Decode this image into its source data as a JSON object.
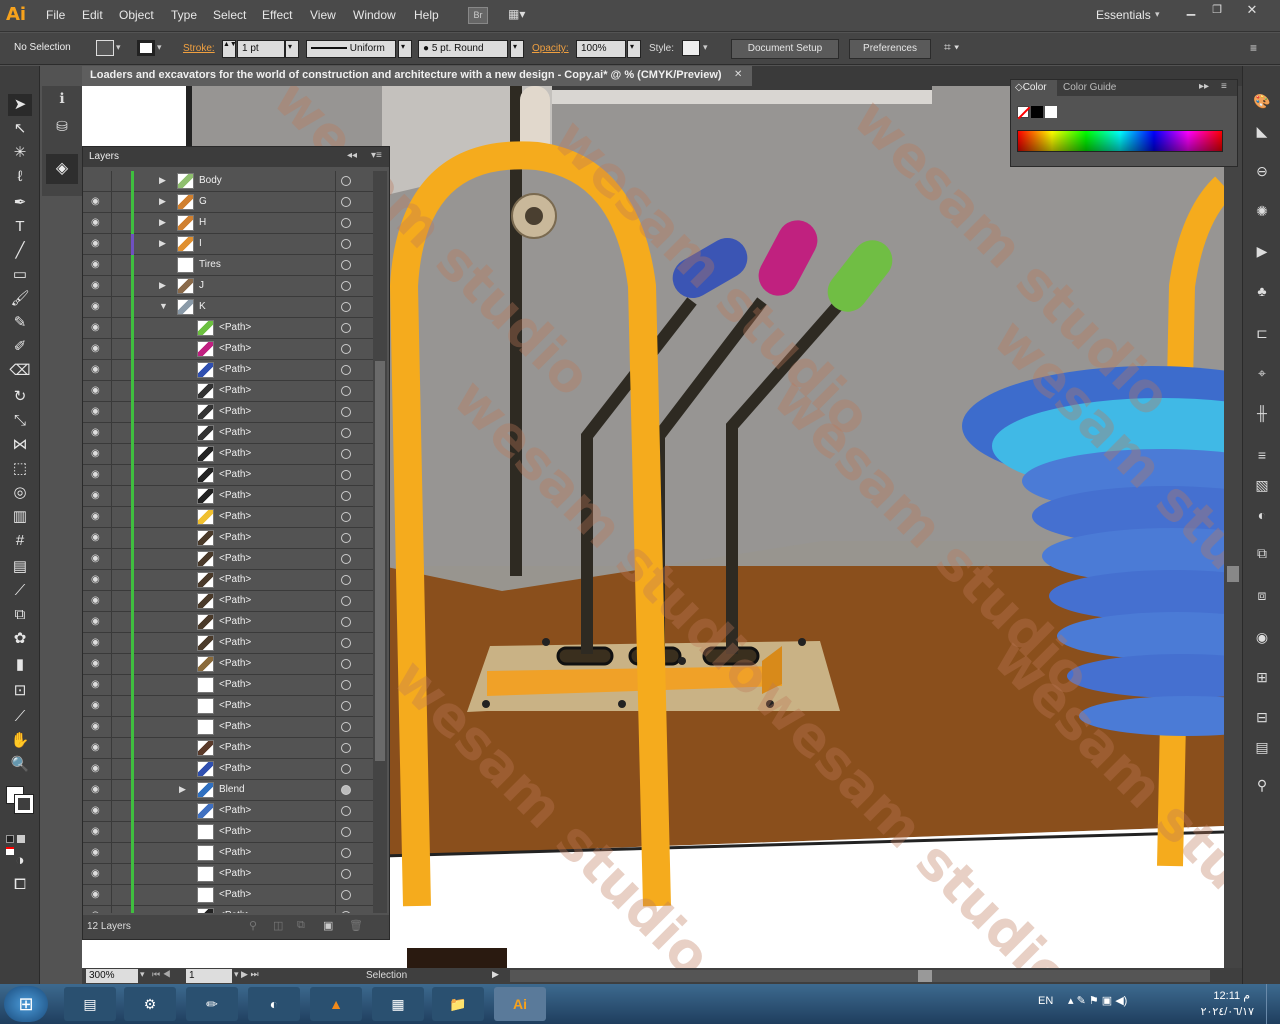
{
  "app": {
    "logo": "Ai",
    "workspace": "Essentials",
    "menus": [
      "File",
      "Edit",
      "Object",
      "Type",
      "Select",
      "Effect",
      "View",
      "Window",
      "Help"
    ],
    "bridge": "Br"
  },
  "control": {
    "selection": "No Selection",
    "stroke_label": "Stroke:",
    "stroke_value": "1 pt",
    "profile": "Uniform",
    "brush": "5 pt. Round",
    "opacity_label": "Opacity:",
    "opacity_value": "100%",
    "style_label": "Style:",
    "doc_setup": "Document Setup",
    "preferences": "Preferences"
  },
  "document": {
    "tab_title": "Loaders and excavators for the world of construction and architecture with a new design - Copy.ai* @ % (CMYK/Preview)"
  },
  "layers": {
    "title": "Layers",
    "footer": "12 Layers",
    "rows": [
      {
        "name": "Body",
        "indent": 0,
        "expand": "right",
        "color": "#3fbf3f",
        "thumb": "#8fbf6f"
      },
      {
        "name": "G",
        "indent": 0,
        "expand": "right",
        "color": "#3fbf3f",
        "thumb": "#d08030"
      },
      {
        "name": "H",
        "indent": 0,
        "expand": "right",
        "color": "#3fbf3f",
        "thumb": "#d08030"
      },
      {
        "name": "I",
        "indent": 0,
        "expand": "right",
        "color": "#7050c0",
        "thumb": "#e09030"
      },
      {
        "name": "Tires",
        "indent": 0,
        "expand": "",
        "color": "#3fbf3f",
        "thumb": "#ffffff"
      },
      {
        "name": "J",
        "indent": 0,
        "expand": "right",
        "color": "#3fbf3f",
        "thumb": "#8a6a4a"
      },
      {
        "name": "K",
        "indent": 0,
        "expand": "down",
        "color": "#3fbf3f",
        "thumb": "#8a9aa8"
      },
      {
        "name": "<Path>",
        "indent": 1,
        "expand": "",
        "color": "#3fbf3f",
        "thumb": "#6cc040"
      },
      {
        "name": "<Path>",
        "indent": 1,
        "expand": "",
        "color": "#3fbf3f",
        "thumb": "#c02080"
      },
      {
        "name": "<Path>",
        "indent": 1,
        "expand": "",
        "color": "#3fbf3f",
        "thumb": "#3050b0"
      },
      {
        "name": "<Path>",
        "indent": 1,
        "expand": "",
        "color": "#3fbf3f",
        "thumb": "#333333"
      },
      {
        "name": "<Path>",
        "indent": 1,
        "expand": "",
        "color": "#3fbf3f",
        "thumb": "#333333"
      },
      {
        "name": "<Path>",
        "indent": 1,
        "expand": "",
        "color": "#3fbf3f",
        "thumb": "#333333"
      },
      {
        "name": "<Path>",
        "indent": 1,
        "expand": "",
        "color": "#3fbf3f",
        "thumb": "#222222"
      },
      {
        "name": "<Path>",
        "indent": 1,
        "expand": "",
        "color": "#3fbf3f",
        "thumb": "#222222"
      },
      {
        "name": "<Path>",
        "indent": 1,
        "expand": "",
        "color": "#3fbf3f",
        "thumb": "#222222"
      },
      {
        "name": "<Path>",
        "indent": 1,
        "expand": "",
        "color": "#3fbf3f",
        "thumb": "#f0c030"
      },
      {
        "name": "<Path>",
        "indent": 1,
        "expand": "",
        "color": "#3fbf3f",
        "thumb": "#4a3a2a"
      },
      {
        "name": "<Path>",
        "indent": 1,
        "expand": "",
        "color": "#3fbf3f",
        "thumb": "#4a3a2a"
      },
      {
        "name": "<Path>",
        "indent": 1,
        "expand": "",
        "color": "#3fbf3f",
        "thumb": "#4a3a2a"
      },
      {
        "name": "<Path>",
        "indent": 1,
        "expand": "",
        "color": "#3fbf3f",
        "thumb": "#4a3a2a"
      },
      {
        "name": "<Path>",
        "indent": 1,
        "expand": "",
        "color": "#3fbf3f",
        "thumb": "#4a3a2a"
      },
      {
        "name": "<Path>",
        "indent": 1,
        "expand": "",
        "color": "#3fbf3f",
        "thumb": "#4a3a2a"
      },
      {
        "name": "<Path>",
        "indent": 1,
        "expand": "",
        "color": "#3fbf3f",
        "thumb": "#8a6a3a"
      },
      {
        "name": "<Path>",
        "indent": 1,
        "expand": "",
        "color": "#3fbf3f",
        "thumb": "#ffffff"
      },
      {
        "name": "<Path>",
        "indent": 1,
        "expand": "",
        "color": "#3fbf3f",
        "thumb": "#ffffff"
      },
      {
        "name": "<Path>",
        "indent": 1,
        "expand": "",
        "color": "#3fbf3f",
        "thumb": "#ffffff"
      },
      {
        "name": "<Path>",
        "indent": 1,
        "expand": "",
        "color": "#3fbf3f",
        "thumb": "#5a3a2a"
      },
      {
        "name": "<Path>",
        "indent": 1,
        "expand": "",
        "color": "#3fbf3f",
        "thumb": "#3050b0"
      },
      {
        "name": "Blend",
        "indent": 1,
        "expand": "right",
        "color": "#3fbf3f",
        "thumb": "#3070c0"
      },
      {
        "name": "<Path>",
        "indent": 1,
        "expand": "",
        "color": "#3fbf3f",
        "thumb": "#4070c0"
      },
      {
        "name": "<Path>",
        "indent": 1,
        "expand": "",
        "color": "#3fbf3f",
        "thumb": "#ffffff"
      },
      {
        "name": "<Path>",
        "indent": 1,
        "expand": "",
        "color": "#3fbf3f",
        "thumb": "#ffffff"
      },
      {
        "name": "<Path>",
        "indent": 1,
        "expand": "",
        "color": "#3fbf3f",
        "thumb": "#ffffff"
      },
      {
        "name": "<Path>",
        "indent": 1,
        "expand": "",
        "color": "#3fbf3f",
        "thumb": "#ffffff"
      },
      {
        "name": "<Path>",
        "indent": 1,
        "expand": "",
        "color": "#3fbf3f",
        "thumb": "#222222"
      }
    ]
  },
  "color_panel": {
    "tab_color": "Color",
    "tab_guide": "Color Guide"
  },
  "status": {
    "zoom": "300%",
    "artboard": "1",
    "tool": "Selection"
  },
  "taskbar": {
    "lang": "EN",
    "time": "12:11 م",
    "date": "٢٠٢٤/٠٦/١٧"
  },
  "watermark": "wesam studio"
}
